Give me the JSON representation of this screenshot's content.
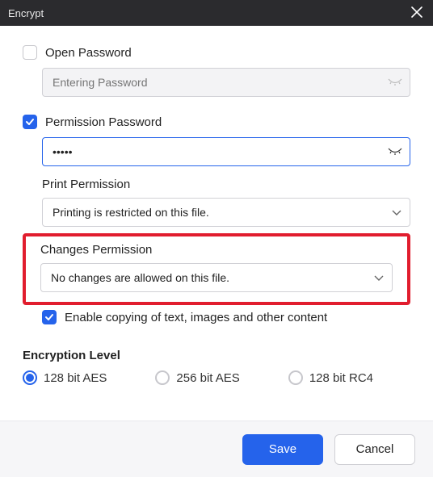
{
  "title": "Encrypt",
  "open_pw": {
    "label": "Open Password",
    "checked": false,
    "placeholder": "Entering Password",
    "value": ""
  },
  "perm_pw": {
    "label": "Permission Password",
    "checked": true,
    "value": "•••••"
  },
  "print_perm": {
    "label": "Print Permission",
    "value": "Printing is restricted on this file."
  },
  "changes_perm": {
    "label": "Changes Permission",
    "value": "No changes are allowed on this file."
  },
  "enable_copy": {
    "label": "Enable copying of text, images and other content",
    "checked": true
  },
  "enc_level": {
    "label": "Encryption Level",
    "options": [
      "128 bit AES",
      "256 bit AES",
      "128 bit RC4"
    ],
    "selected_index": 0
  },
  "buttons": {
    "save": "Save",
    "cancel": "Cancel"
  }
}
